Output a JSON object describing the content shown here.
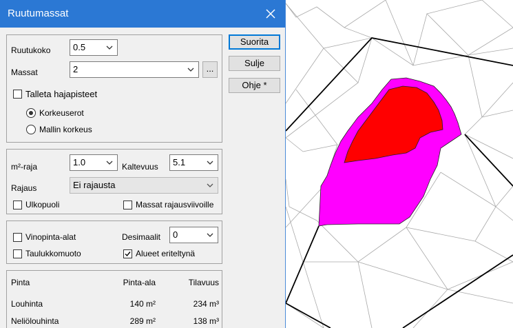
{
  "dialog": {
    "title": "Ruutumassat",
    "grid_size_label": "Ruutukoko",
    "grid_size_value": "0.5",
    "masses_label": "Massat",
    "masses_value": "2",
    "browse_label": "...",
    "save_points_label": "Talleta hajapisteet",
    "radio_height_diff": "Korkeuserot",
    "radio_model_height": "Mallin korkeus",
    "m2_limit_label": "m²-raja",
    "m2_limit_value": "1.0",
    "slope_label": "Kaltevuus",
    "slope_value": "5.1",
    "bounding_label": "Rajaus",
    "bounding_value": "Ei rajausta",
    "outside_label": "Ulkopuoli",
    "masses_to_bounds_label": "Massat rajausviivoille",
    "slope_areas_label": "Vinopinta-alat",
    "decimals_label": "Desimaalit",
    "decimals_value": "0",
    "table_format_label": "Taulukkomuoto",
    "areas_separately_label": "Alueet eriteltynä",
    "buttons": {
      "run": "Suorita",
      "close": "Sulje",
      "help": "Ohje *"
    },
    "results": {
      "headers": [
        "Pinta",
        "Pinta-ala",
        "Tilavuus"
      ],
      "rows": [
        {
          "name": "Louhinta",
          "area": "140 m²",
          "volume": "234 m³"
        },
        {
          "name": "Neliölouhinta",
          "area": "289 m²",
          "volume": "138 m³"
        }
      ]
    }
  },
  "colors": {
    "titlebar": "#2b78d4",
    "mass_magenta": "#ff00ff",
    "mass_red": "#ff0000"
  }
}
